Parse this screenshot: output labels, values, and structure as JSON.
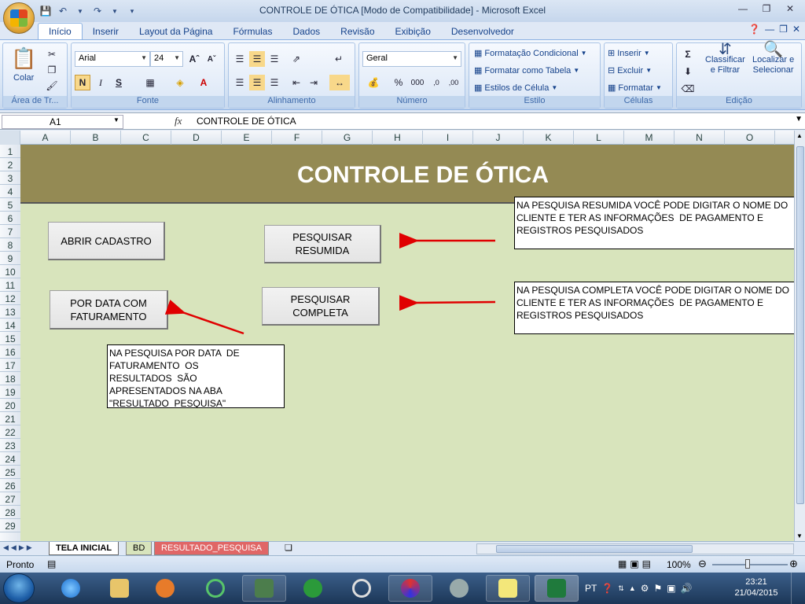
{
  "window": {
    "title": "CONTROLE DE ÓTICA  [Modo de Compatibilidade] - Microsoft Excel"
  },
  "tabs": [
    "Início",
    "Inserir",
    "Layout da Página",
    "Fórmulas",
    "Dados",
    "Revisão",
    "Exibição",
    "Desenvolvedor"
  ],
  "ribbon": {
    "clipboard": {
      "paste": "Colar",
      "label": "Área de Tr..."
    },
    "font": {
      "name": "Arial",
      "size": "24",
      "bold": "N",
      "italic": "I",
      "underline": "S",
      "label": "Fonte"
    },
    "alignment": {
      "label": "Alinhamento"
    },
    "number": {
      "format": "Geral",
      "percent": "%",
      "thousands": "000",
      "label": "Número"
    },
    "styles": {
      "conditional": "Formatação Condicional",
      "table": "Formatar como Tabela",
      "cell": "Estilos de Célula",
      "label": "Estilo"
    },
    "cells": {
      "insert": "Inserir",
      "delete": "Excluir",
      "format": "Formatar",
      "label": "Células"
    },
    "editing": {
      "sort": "Classificar",
      "sort2": "e Filtrar",
      "find": "Localizar e",
      "find2": "Selecionar",
      "label": "Edição"
    }
  },
  "formula_bar": {
    "cell_ref": "A1",
    "fx": "fx",
    "content": "CONTROLE DE ÓTICA"
  },
  "columns": [
    "A",
    "B",
    "C",
    "D",
    "E",
    "F",
    "G",
    "H",
    "I",
    "J",
    "K",
    "L",
    "M",
    "N",
    "O"
  ],
  "rows": [
    "1",
    "2",
    "3",
    "4",
    "5",
    "6",
    "7",
    "8",
    "9",
    "10",
    "11",
    "12",
    "13",
    "14",
    "15",
    "16",
    "17",
    "18",
    "19",
    "20",
    "21",
    "22",
    "23",
    "24",
    "25",
    "26",
    "27",
    "28",
    "29"
  ],
  "sheet": {
    "title": "CONTROLE DE ÓTICA",
    "btn_cadastro": "ABRIR CADASTRO",
    "btn_resumida": "PESQUISAR\nRESUMIDA",
    "btn_data": "POR DATA COM\nFATURAMENTO",
    "btn_completa": "PESQUISAR\nCOMPLETA",
    "note_resumida": "NA PESQUISA RESUMIDA VOCÊ PODE DIGITAR O NOME DO\nCLIENTE E TER AS INFORMAÇÕES  DE PAGAMENTO E\nREGISTROS PESQUISADOS",
    "note_completa": "NA PESQUISA COMPLETA VOCÊ PODE DIGITAR O NOME DO\nCLIENTE E TER AS INFORMAÇÕES  DE PAGAMENTO E\nREGISTROS PESQUISADOS",
    "note_data": "NA PESQUISA POR DATA  DE\nFATURAMENTO  OS\nRESULTADOS  SÃO\nAPRESENTADOS NA ABA\n\"RESULTADO_PESQUISA\""
  },
  "sheet_tabs": [
    "TELA INICIAL",
    "BD",
    "RESULTADO_PESQUISA"
  ],
  "status": {
    "ready": "Pronto",
    "zoom": "100%"
  },
  "taskbar": {
    "lang": "PT",
    "time": "23:21",
    "date": "21/04/2015"
  },
  "colors": {
    "banner": "#948a54",
    "sheet_bg": "#d8e4bc",
    "arrow": "#e00000"
  }
}
